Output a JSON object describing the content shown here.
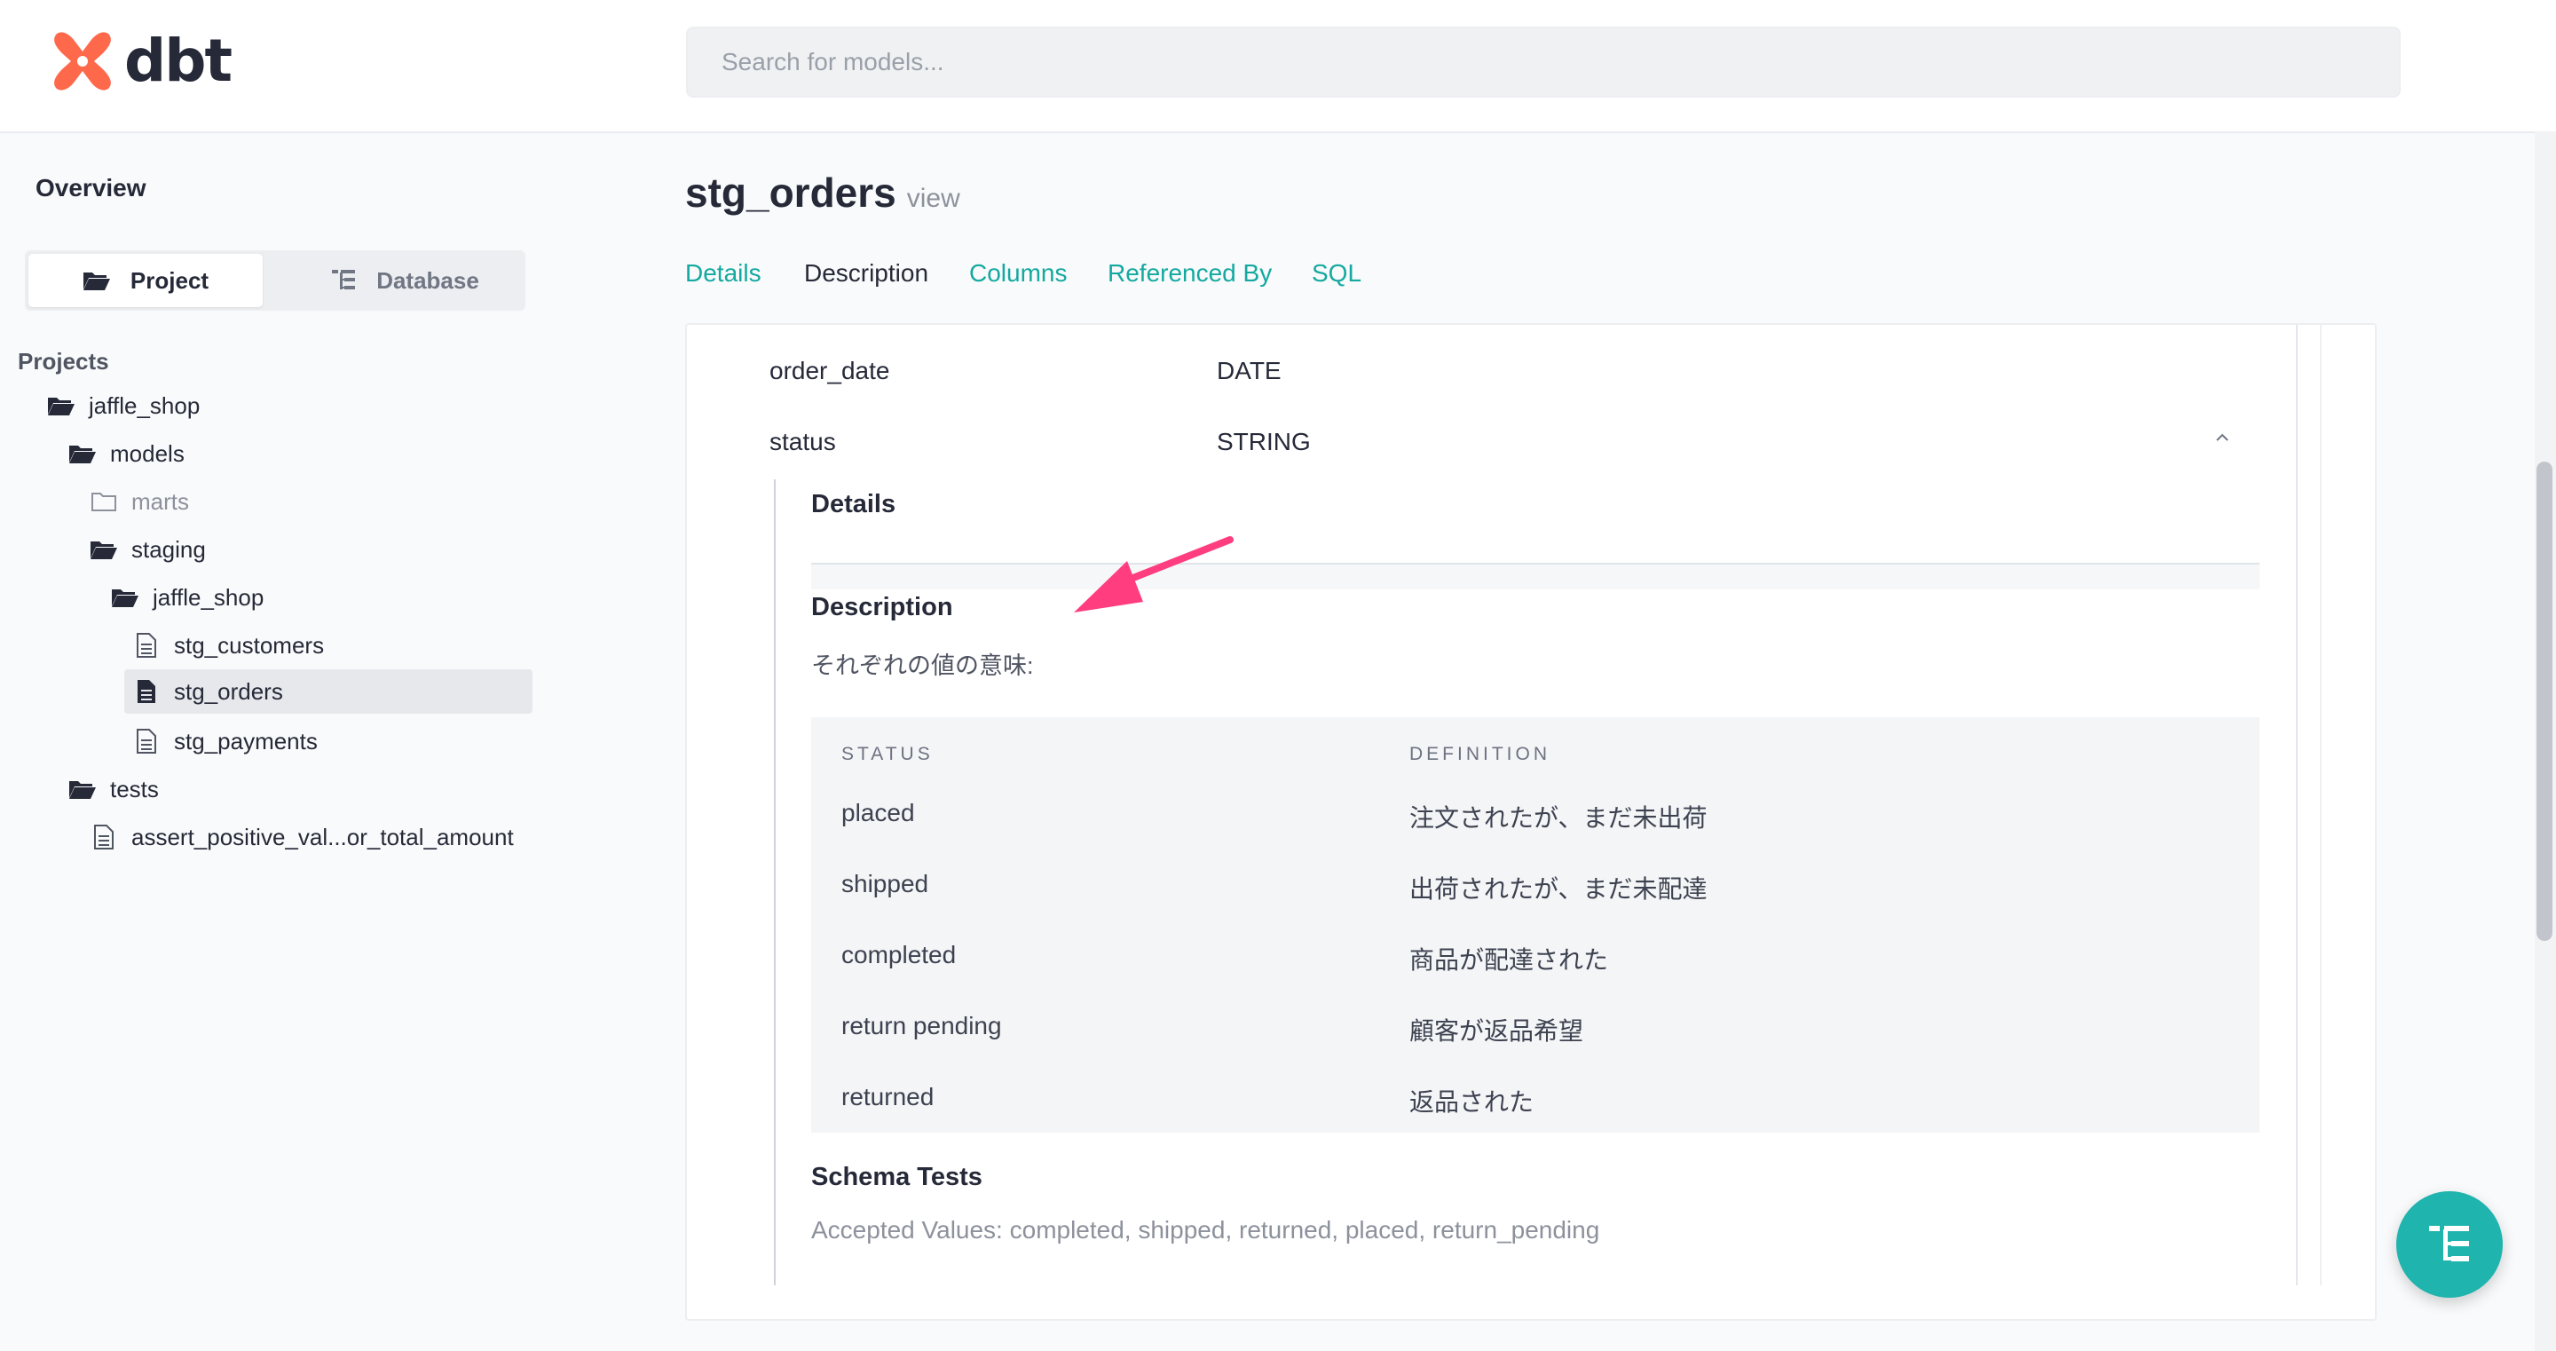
{
  "brand": {
    "name": "dbt",
    "accent": "#ff694b"
  },
  "search": {
    "placeholder": "Search for models..."
  },
  "sidebar": {
    "overview": "Overview",
    "toggle": {
      "project": "Project",
      "database": "Database"
    },
    "projects_label": "Projects",
    "tree": [
      {
        "label": "jaffle_shop",
        "icon": "folder-open-icon"
      },
      {
        "label": "models",
        "icon": "folder-open-icon"
      },
      {
        "label": "marts",
        "icon": "folder-outline-icon"
      },
      {
        "label": "staging",
        "icon": "folder-open-icon"
      },
      {
        "label": "jaffle_shop",
        "icon": "folder-open-icon"
      },
      {
        "label": "stg_customers",
        "icon": "file-icon"
      },
      {
        "label": "stg_orders",
        "icon": "file-filled-icon",
        "selected": true
      },
      {
        "label": "stg_payments",
        "icon": "file-icon"
      },
      {
        "label": "tests",
        "icon": "folder-open-icon"
      },
      {
        "label": "assert_positive_val...or_total_amount",
        "icon": "file-icon"
      }
    ]
  },
  "model": {
    "name": "stg_orders",
    "type": "view"
  },
  "tabs": [
    {
      "label": "Details"
    },
    {
      "label": "Description",
      "active": true
    },
    {
      "label": "Columns"
    },
    {
      "label": "Referenced By"
    },
    {
      "label": "SQL"
    }
  ],
  "columns": [
    {
      "name": "order_date",
      "type": "DATE"
    },
    {
      "name": "status",
      "type": "STRING"
    }
  ],
  "column_detail": {
    "details_heading": "Details",
    "description_heading": "Description",
    "description_text": "それぞれの値の意味:",
    "table_headers": {
      "status": "STATUS",
      "definition": "DEFINITION"
    },
    "rows": [
      {
        "status": "placed",
        "definition": "注文されたが、まだ未出荷"
      },
      {
        "status": "shipped",
        "definition": "出荷されたが、まだ未配達"
      },
      {
        "status": "completed",
        "definition": "商品が配達された"
      },
      {
        "status": "return pending",
        "definition": "顧客が返品希望"
      },
      {
        "status": "returned",
        "definition": "返品された"
      }
    ],
    "schema_tests_heading": "Schema Tests",
    "schema_tests_text": "Accepted Values: completed, shipped, returned, placed, return_pending"
  },
  "annotation": {
    "arrow_color": "#ff3d7f"
  },
  "fab": {
    "icon": "lineage-graph-icon",
    "color": "#1fb4ad"
  }
}
